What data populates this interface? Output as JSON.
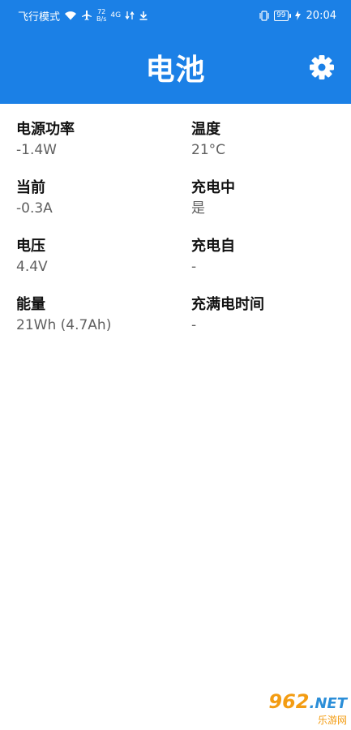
{
  "status_bar": {
    "left_text": "飞行模式",
    "speed_value": "72",
    "speed_unit": "B/s",
    "signal_text": "4G",
    "battery": "99",
    "time": "20:04"
  },
  "app_bar": {
    "title": "电池"
  },
  "stats": [
    {
      "label": "电源功率",
      "value": "-1.4W"
    },
    {
      "label": "温度",
      "value": "21°C"
    },
    {
      "label": "当前",
      "value": "-0.3A"
    },
    {
      "label": "充电中",
      "value": "是"
    },
    {
      "label": "电压",
      "value": "4.4V"
    },
    {
      "label": "充电自",
      "value": "-"
    },
    {
      "label": "能量",
      "value": "21Wh (4.7Ah)"
    },
    {
      "label": "充满电时间",
      "value": "-"
    }
  ],
  "watermark": {
    "top": "962",
    "top_suffix": ".NET",
    "bottom": "乐游网"
  },
  "colors": {
    "primary": "#1b80e6",
    "label": "#111111",
    "value": "#5f5f5f"
  }
}
